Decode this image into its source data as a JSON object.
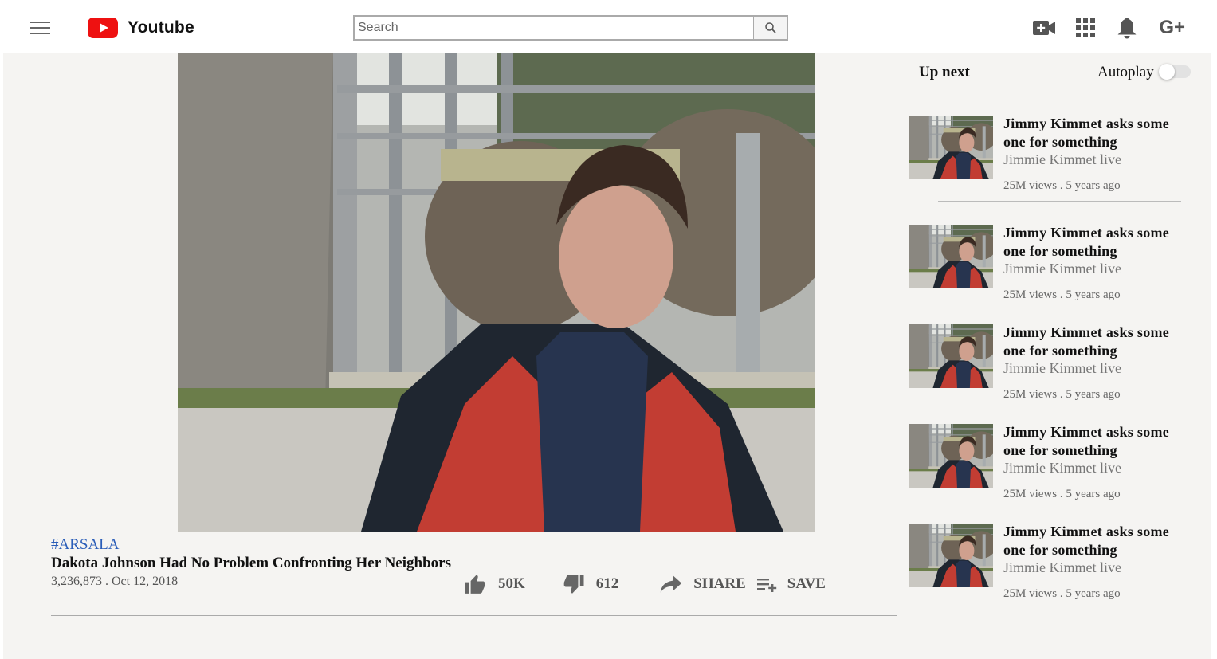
{
  "header": {
    "app_title": "Youtube",
    "search_placeholder": "Search",
    "icons": [
      "menu-icon",
      "youtube-logo-icon",
      "search-icon",
      "video-camera-add-icon",
      "apps-grid-icon",
      "notification-bell-icon",
      "google-plus-icon"
    ],
    "gplus_label": "G+",
    "colors": {
      "logo_red": "#ee1111",
      "link_blue": "#2a5db8",
      "content_bg": "#f5f4f2"
    }
  },
  "video": {
    "hashtag": "#ARSALA",
    "title": "Dakota Johnson Had No Problem Confronting Her Neighbors",
    "meta": "3,236,873 . Oct 12, 2018",
    "likes": "50K",
    "dislikes": "612",
    "share_label": "SHARE",
    "save_label": "SAVE"
  },
  "sidebar": {
    "up_next_label": "Up next",
    "autoplay_label": "Autoplay",
    "autoplay_on": false,
    "items": [
      {
        "title": "Jimmy Kimmet asks some one for something",
        "channel": "Jimmie Kimmet live",
        "meta": "25M views . 5 years ago"
      },
      {
        "title": "Jimmy Kimmet asks some one for something",
        "channel": "Jimmie Kimmet live",
        "meta": "25M views . 5 years ago"
      },
      {
        "title": "Jimmy Kimmet asks some one for something",
        "channel": "Jimmie Kimmet live",
        "meta": "25M views . 5 years ago"
      },
      {
        "title": "Jimmy Kimmet asks some one for something",
        "channel": "Jimmie Kimmet live",
        "meta": "25M views . 5 years ago"
      },
      {
        "title": "Jimmy Kimmet asks some one for something",
        "channel": "Jimmie Kimmet live",
        "meta": "25M views . 5 years ago"
      }
    ]
  }
}
